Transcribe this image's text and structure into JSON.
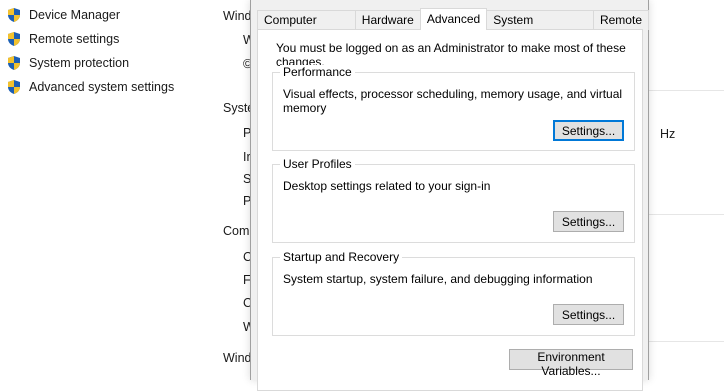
{
  "left_panel": {
    "items": [
      {
        "label": "Device Manager",
        "icon": "shield-icon"
      },
      {
        "label": "Remote settings",
        "icon": "shield-icon"
      },
      {
        "label": "System protection",
        "icon": "shield-icon"
      },
      {
        "label": "Advanced system settings",
        "icon": "shield-icon"
      }
    ]
  },
  "background_window": {
    "section_windows": "Windo",
    "w1": "W",
    "c1": "©",
    "section_system": "Syste",
    "p1": "P",
    "i1": "Ir",
    "s1": "S",
    "p2": "P",
    "section_computer": "Com",
    "c2": "C",
    "f1": "F",
    "c3": "C",
    "w2": "W",
    "section_windows2": "Windo",
    "hz": "Hz"
  },
  "dialog": {
    "tabs": [
      {
        "label": "Computer Name"
      },
      {
        "label": "Hardware"
      },
      {
        "label": "Advanced",
        "active": true
      },
      {
        "label": "System Protection"
      },
      {
        "label": "Remote"
      }
    ],
    "admin_note": "You must be logged on as an Administrator to make most of these changes.",
    "performance": {
      "title": "Performance",
      "description": "Visual effects, processor scheduling, memory usage, and virtual memory",
      "button": "Settings..."
    },
    "user_profiles": {
      "title": "User Profiles",
      "description": "Desktop settings related to your sign-in",
      "button": "Settings..."
    },
    "startup_recovery": {
      "title": "Startup and Recovery",
      "description": "System startup, system failure, and debugging information",
      "button": "Settings..."
    },
    "env_button": "Environment Variables..."
  },
  "colors": {
    "dialog_bg": "#f0f0f0",
    "focus_border": "#0078d7",
    "shield_blue": "#1c5fb4",
    "shield_yellow": "#f2c12e"
  }
}
